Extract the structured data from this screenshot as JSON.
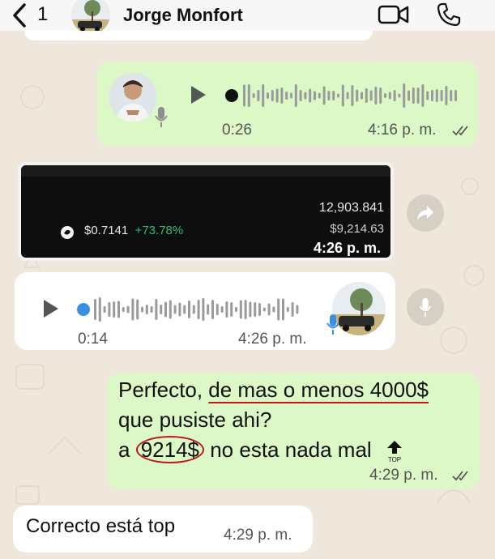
{
  "header": {
    "back_label": "1",
    "contact_name": "Jorge Monfort",
    "icons": [
      "chevron-left-icon",
      "video-call-icon",
      "phone-icon"
    ]
  },
  "messages": [
    {
      "kind": "voice-note",
      "direction": "outgoing",
      "duration": "0:26",
      "time": "4:16 p. m.",
      "read": true
    },
    {
      "kind": "image",
      "direction": "incoming",
      "crypto": {
        "price": "$0.7141",
        "change": "+73.78%",
        "amount": "12,903.841",
        "usd_value": "$9,214.63"
      },
      "time": "4:26 p. m."
    },
    {
      "kind": "voice-note",
      "direction": "incoming",
      "duration": "0:14",
      "time": "4:26 p. m."
    },
    {
      "kind": "text",
      "direction": "outgoing",
      "line1_a": "Perfecto, ",
      "line1_b": "de mas o menos 4000$",
      "line2": "que pusiste ahi?",
      "line3_a": "a ",
      "line3_b": "9214$",
      "line3_c": " no esta nada mal",
      "emoji_text": "TOP",
      "time": "4:29 p. m.",
      "read": true
    },
    {
      "kind": "text",
      "direction": "incoming",
      "text": "Correcto está top",
      "time": "4:29 p. m."
    }
  ],
  "colors": {
    "outgoing_bubble": "#dcf8c6",
    "incoming_bubble": "#ffffff",
    "background": "#efe7dc",
    "annotation_red": "#c0161a",
    "positive_green": "#2fbf71"
  }
}
